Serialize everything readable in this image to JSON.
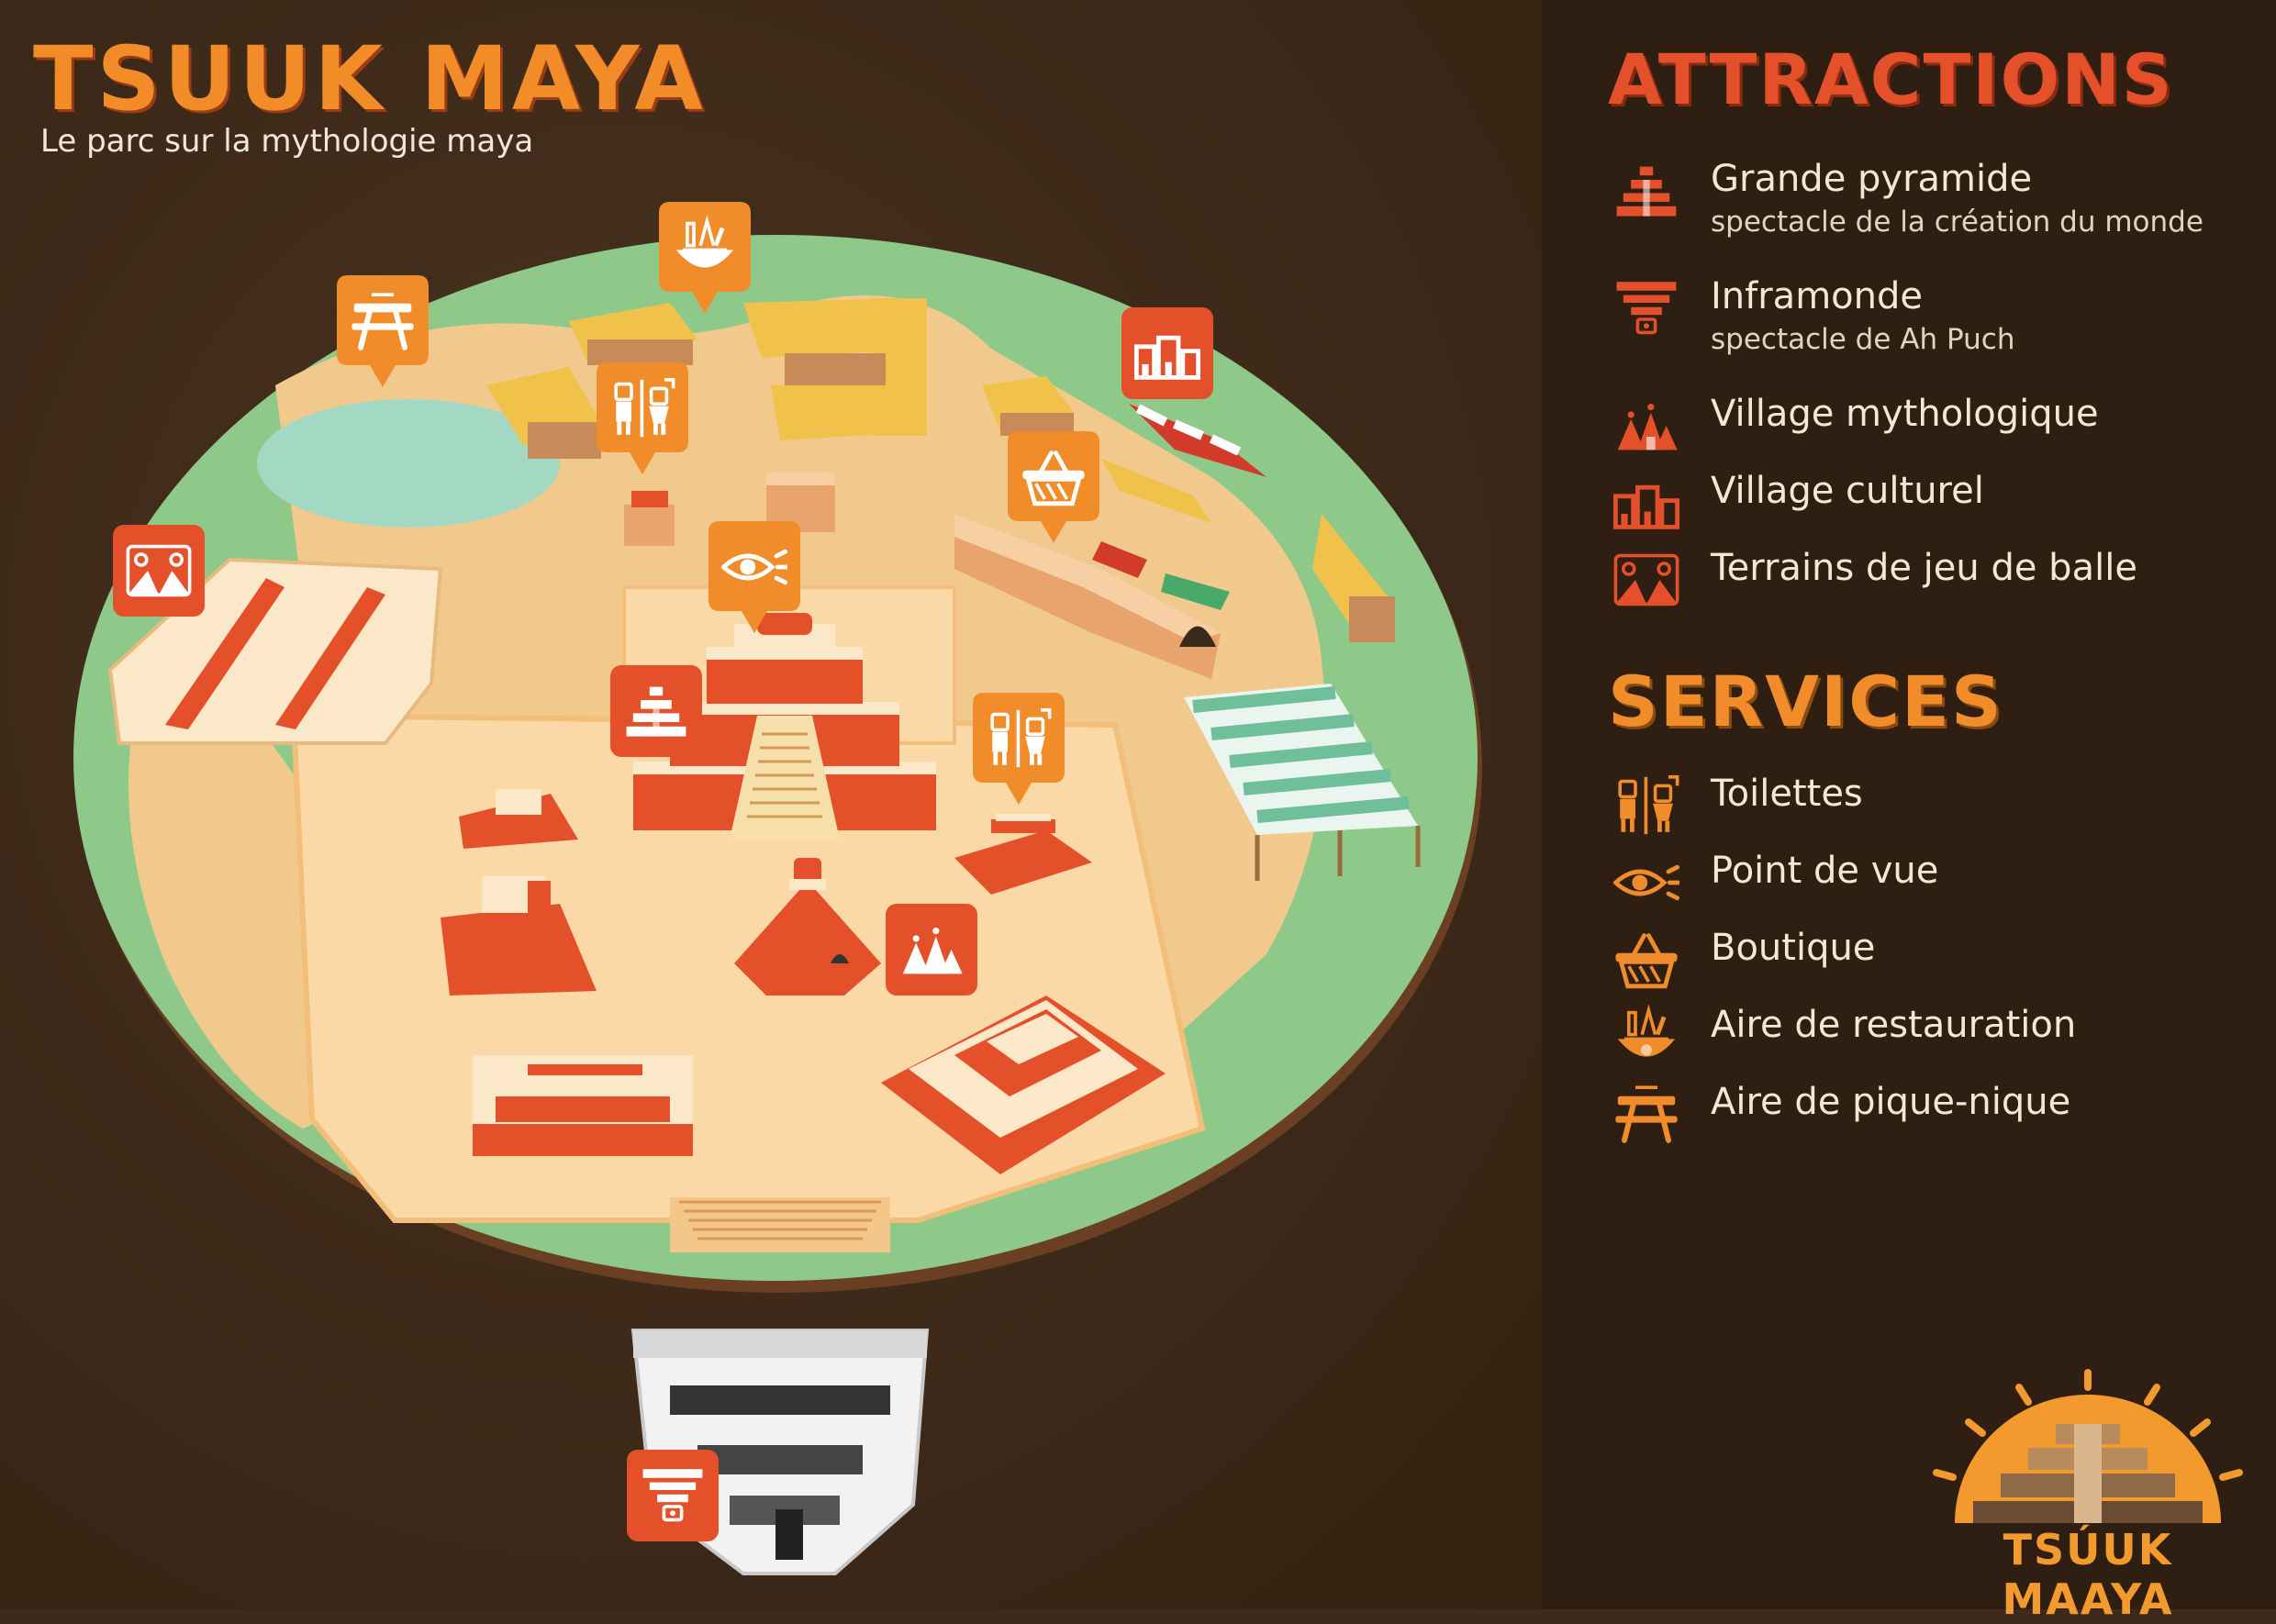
{
  "header": {
    "title": "TSUUK MAYA",
    "subtitle": "Le parc sur la mythologie maya"
  },
  "legend": {
    "attractions_heading": "ATTRACTIONS",
    "attractions": [
      {
        "icon": "pyramid-icon",
        "label": "Grande pyramide",
        "sub": "spectacle de la création du monde"
      },
      {
        "icon": "underworld-icon",
        "label": "Inframonde",
        "sub": "spectacle de Ah Puch"
      },
      {
        "icon": "mythological-village-icon",
        "label": "Village mythologique"
      },
      {
        "icon": "cultural-village-icon",
        "label": "Village culturel"
      },
      {
        "icon": "ballgame-icon",
        "label": "Terrains de jeu de balle"
      }
    ],
    "services_heading": "SERVICES",
    "services": [
      {
        "icon": "toilets-icon",
        "label": "Toilettes"
      },
      {
        "icon": "viewpoint-icon",
        "label": "Point de vue"
      },
      {
        "icon": "shop-icon",
        "label": "Boutique"
      },
      {
        "icon": "restaurant-icon",
        "label": "Aire de restauration"
      },
      {
        "icon": "picnic-icon",
        "label": "Aire de pique-nique"
      }
    ]
  },
  "brand": {
    "name": "TSÚUK MAAYA"
  },
  "colors": {
    "background": "#3d2a1a",
    "attraction_red": "#e4502a",
    "service_orange": "#f08c2a",
    "grass": "#8fc98a",
    "sand": "#f5d3a0",
    "cream": "#fbe8c8"
  },
  "map_markers": [
    {
      "icon": "picnic-icon",
      "type": "service"
    },
    {
      "icon": "restaurant-icon",
      "type": "service"
    },
    {
      "icon": "cultural-village-icon",
      "type": "attraction"
    },
    {
      "icon": "toilets-icon",
      "type": "service"
    },
    {
      "icon": "shop-icon",
      "type": "service"
    },
    {
      "icon": "ballgame-icon",
      "type": "attraction"
    },
    {
      "icon": "viewpoint-icon",
      "type": "service"
    },
    {
      "icon": "pyramid-icon",
      "type": "attraction"
    },
    {
      "icon": "toilets-icon",
      "type": "service"
    },
    {
      "icon": "mythological-village-icon",
      "type": "attraction"
    },
    {
      "icon": "underworld-icon",
      "type": "attraction"
    }
  ]
}
